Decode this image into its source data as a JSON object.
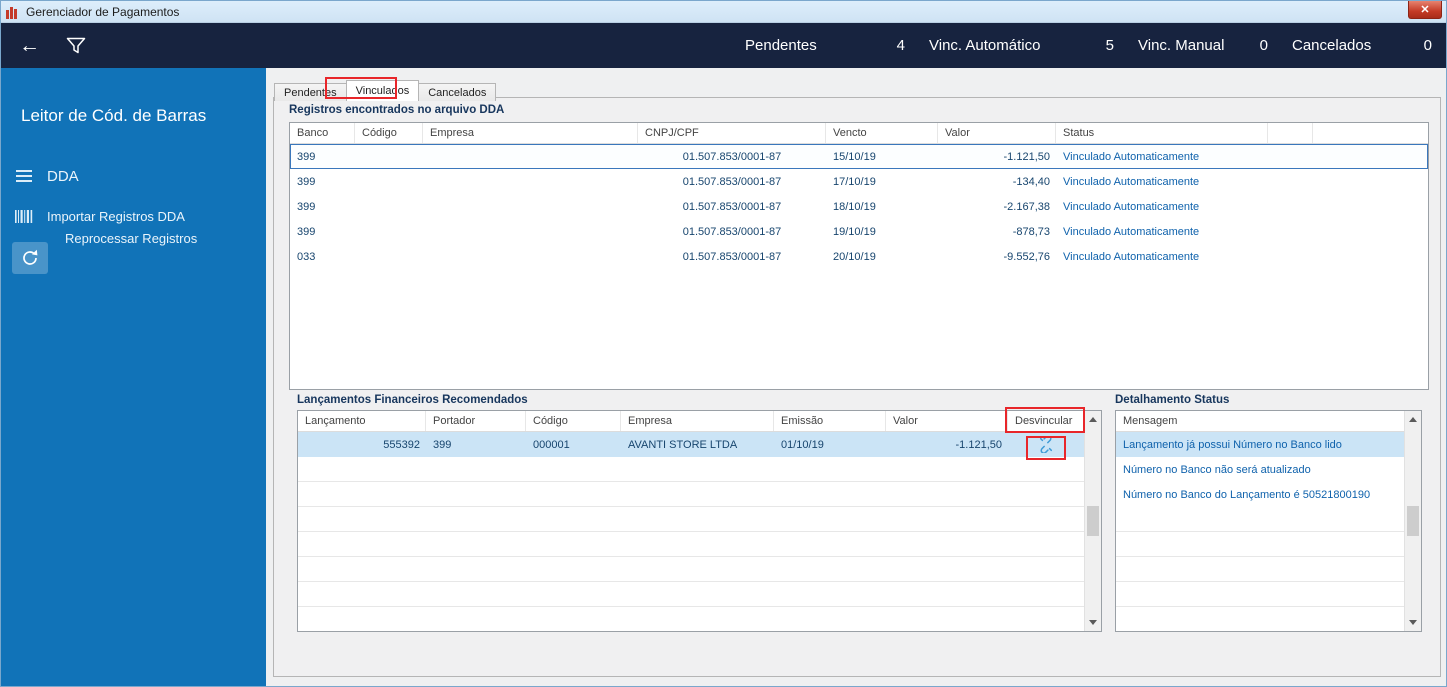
{
  "window": {
    "title": "Gerenciador de Pagamentos",
    "close_label": "✕"
  },
  "toolbar": {
    "counters": [
      {
        "label": "Pendentes",
        "value": "4"
      },
      {
        "label": "Vinc. Automático",
        "value": "5"
      },
      {
        "label": "Vinc. Manual",
        "value": "0"
      },
      {
        "label": "Cancelados",
        "value": "0"
      }
    ]
  },
  "sidebar": {
    "title": "Leitor de Cód. de Barras",
    "items": [
      {
        "label": "DDA",
        "icon": "menu-icon"
      },
      {
        "label": "Importar Registros DDA",
        "icon": "barcode-icon"
      },
      {
        "label": "Reprocessar Registros",
        "icon": "refresh-icon"
      }
    ]
  },
  "tabs": [
    {
      "label": "Pendentes"
    },
    {
      "label": "Vinculados"
    },
    {
      "label": "Cancelados"
    }
  ],
  "dda_table": {
    "title": "Registros encontrados no arquivo DDA",
    "columns": [
      "Banco",
      "Código",
      "Empresa",
      "CNPJ/CPF",
      "Vencto",
      "Valor",
      "Status"
    ],
    "rows": [
      {
        "banco": "399",
        "codigo": "",
        "empresa": "",
        "cnpj": "01.507.853/0001-87",
        "vencto": "15/10/19",
        "valor": "-1.121,50",
        "status": "Vinculado Automaticamente"
      },
      {
        "banco": "399",
        "codigo": "",
        "empresa": "",
        "cnpj": "01.507.853/0001-87",
        "vencto": "17/10/19",
        "valor": "-134,40",
        "status": "Vinculado Automaticamente"
      },
      {
        "banco": "399",
        "codigo": "",
        "empresa": "",
        "cnpj": "01.507.853/0001-87",
        "vencto": "18/10/19",
        "valor": "-2.167,38",
        "status": "Vinculado Automaticamente"
      },
      {
        "banco": "399",
        "codigo": "",
        "empresa": "",
        "cnpj": "01.507.853/0001-87",
        "vencto": "19/10/19",
        "valor": "-878,73",
        "status": "Vinculado Automaticamente"
      },
      {
        "banco": "033",
        "codigo": "",
        "empresa": "",
        "cnpj": "01.507.853/0001-87",
        "vencto": "20/10/19",
        "valor": "-9.552,76",
        "status": "Vinculado Automaticamente"
      }
    ],
    "status_dot_color": "#29b7e8"
  },
  "lancamentos_table": {
    "title": "Lançamentos Financeiros Recomendados",
    "columns": [
      "Lançamento",
      "Portador",
      "Código",
      "Empresa",
      "Emissão",
      "Valor",
      "Desvincular"
    ],
    "rows": [
      {
        "lancamento": "555392",
        "portador": "399",
        "codigo": "000001",
        "empresa": "AVANTI STORE LTDA",
        "emissao": "01/10/19",
        "valor": "-1.121,50"
      }
    ]
  },
  "status_detail": {
    "title": "Detalhamento Status",
    "column": "Mensagem",
    "messages": [
      "Lançamento já possui Número no Banco lido",
      "Número no Banco não será atualizado",
      "Número no Banco do Lançamento é 50521800190"
    ]
  },
  "colors": {
    "sidebar_blue": "#1173b8",
    "toolbar_navy": "#17233f",
    "selection_bg": "#cbe4f6",
    "status_dot": "#29b7e8",
    "annotation_red": "#e8262a",
    "value_text": "#17456e",
    "status_text": "#0f62ac"
  }
}
